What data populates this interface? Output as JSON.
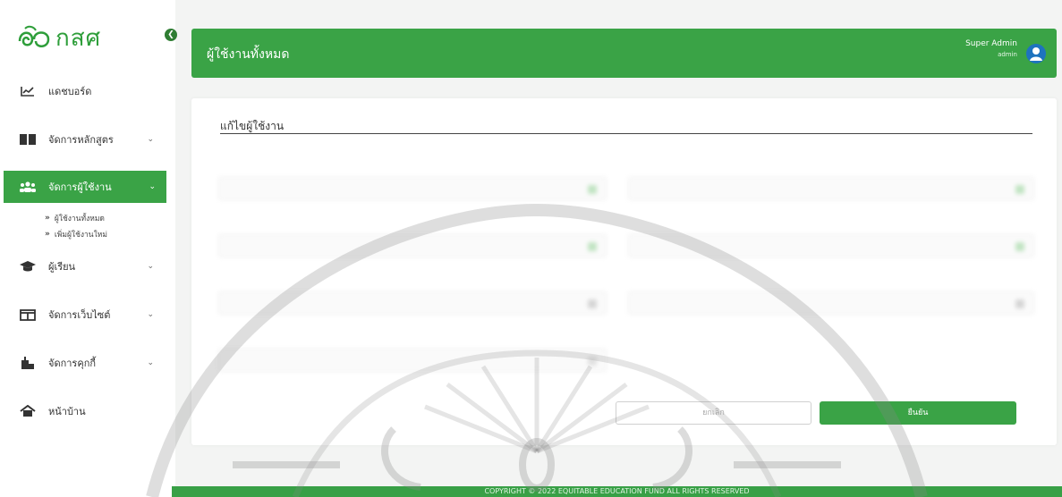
{
  "brand": {
    "logo_text": "กสศ",
    "accent": "#3aa346"
  },
  "sidebar": {
    "items": [
      {
        "label": "แดชบอร์ด",
        "icon": "chart-line-icon",
        "has_chevron": false
      },
      {
        "label": "จัดการหลักสูตร",
        "icon": "book-icon",
        "has_chevron": true
      },
      {
        "label": "จัดการผู้ใช้งาน",
        "icon": "users-icon",
        "has_chevron": true,
        "active": true,
        "subitems": [
          {
            "label": "ผู้ใช้งานทั้งหมด"
          },
          {
            "label": "เพิ่มผู้ใช้งานใหม่"
          }
        ]
      },
      {
        "label": "ผู้เรียน",
        "icon": "graduation-cap-icon",
        "has_chevron": true
      },
      {
        "label": "จัดการเว็บไซต์",
        "icon": "layout-icon",
        "has_chevron": true
      },
      {
        "label": "จัดการคุกกี้",
        "icon": "building-icon",
        "has_chevron": true
      },
      {
        "label": "หน้าบ้าน",
        "icon": "home-icon",
        "has_chevron": false
      }
    ]
  },
  "header": {
    "title": "ผู้ใช้งานทั้งหมด",
    "user_name": "Super Admin",
    "user_role": "admin"
  },
  "form": {
    "title": "แก้ไขผู้ใช้งาน",
    "reset_label": "ยกเลิก",
    "submit_label": "ยืนยัน"
  },
  "footer": {
    "text": "COPYRIGHT © 2022 EQUITABLE EDUCATION FUND ALL RIGHTS RESERVED"
  }
}
